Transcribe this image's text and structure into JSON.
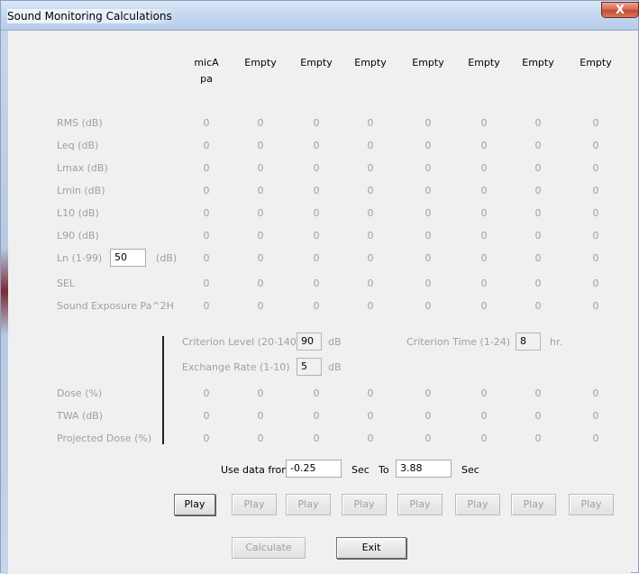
{
  "window": {
    "title": "Sound Monitoring Calculations",
    "close_glyph": "X"
  },
  "columns": [
    [
      "micA",
      "pa"
    ],
    [
      "Empty",
      ""
    ],
    [
      "Empty",
      ""
    ],
    [
      "Empty",
      ""
    ],
    [
      "Empty",
      ""
    ],
    [
      "Empty",
      ""
    ],
    [
      "Empty",
      ""
    ],
    [
      "Empty",
      ""
    ]
  ],
  "metrics": [
    {
      "label": "RMS (dB)",
      "values": [
        "0",
        "0",
        "0",
        "0",
        "0",
        "0",
        "0",
        "0"
      ]
    },
    {
      "label": "Leq (dB)",
      "values": [
        "0",
        "0",
        "0",
        "0",
        "0",
        "0",
        "0",
        "0"
      ]
    },
    {
      "label": "Lmax (dB)",
      "values": [
        "0",
        "0",
        "0",
        "0",
        "0",
        "0",
        "0",
        "0"
      ]
    },
    {
      "label": "Lmin (dB)",
      "values": [
        "0",
        "0",
        "0",
        "0",
        "0",
        "0",
        "0",
        "0"
      ]
    },
    {
      "label": "L10 (dB)",
      "values": [
        "0",
        "0",
        "0",
        "0",
        "0",
        "0",
        "0",
        "0"
      ]
    },
    {
      "label": "L90 (dB)",
      "values": [
        "0",
        "0",
        "0",
        "0",
        "0",
        "0",
        "0",
        "0"
      ]
    },
    {
      "label": "Ln (1-99)",
      "values": [
        "0",
        "0",
        "0",
        "0",
        "0",
        "0",
        "0",
        "0"
      ]
    },
    {
      "label": "SEL",
      "values": [
        "0",
        "0",
        "0",
        "0",
        "0",
        "0",
        "0",
        "0"
      ]
    },
    {
      "label": "Sound Exposure Pa^2H",
      "values": [
        "0",
        "0",
        "0",
        "0",
        "0",
        "0",
        "0",
        "0"
      ]
    }
  ],
  "ln_input": {
    "value": "50",
    "unit": "(dB)"
  },
  "criterion": {
    "level_label": "Criterion Level (20-140)",
    "level_value": "90",
    "level_unit": "dB",
    "time_label": "Criterion Time (1-24)",
    "time_value": "8",
    "time_unit": "hr.",
    "exchange_label": "Exchange Rate (1-10)",
    "exchange_value": "5",
    "exchange_unit": "dB"
  },
  "dose_metrics": [
    {
      "label": "Dose (%)",
      "values": [
        "0",
        "0",
        "0",
        "0",
        "0",
        "0",
        "0",
        "0"
      ]
    },
    {
      "label": "TWA (dB)",
      "values": [
        "0",
        "0",
        "0",
        "0",
        "0",
        "0",
        "0",
        "0"
      ]
    },
    {
      "label": "Projected Dose (%)",
      "values": [
        "0",
        "0",
        "0",
        "0",
        "0",
        "0",
        "0",
        "0"
      ]
    }
  ],
  "range": {
    "use_label": "Use data from",
    "from_value": "-0.25",
    "sec_label": "Sec",
    "to_label": "To",
    "to_value": "3.88",
    "sec2_label": "Sec"
  },
  "play_buttons": [
    "Play",
    "Play",
    "Play",
    "Play",
    "Play",
    "Play",
    "Play",
    "Play"
  ],
  "actions": {
    "calculate": "Calculate",
    "exit": "Exit"
  }
}
